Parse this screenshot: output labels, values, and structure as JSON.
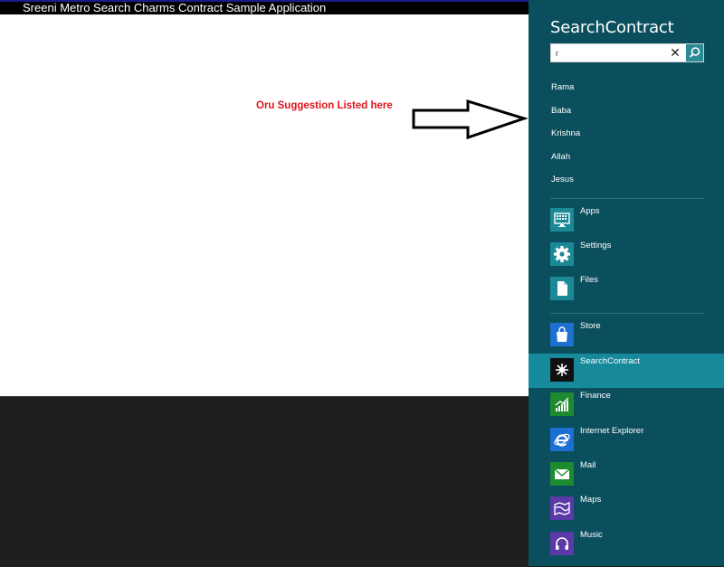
{
  "app": {
    "title": "Sreeni Metro Search Charms Contract Sample Application",
    "annotation": "Oru Suggestion Listed here"
  },
  "charm": {
    "title": "SearchContract",
    "search": {
      "value": "r",
      "placeholder": ""
    },
    "suggestions": [
      {
        "label": "Rama"
      },
      {
        "label": "Baba"
      },
      {
        "label": "Krishna"
      },
      {
        "label": "Allah"
      },
      {
        "label": "Jesus"
      }
    ],
    "system_targets": [
      {
        "label": "Apps",
        "icon": "apps-icon",
        "color": "#1b8a96"
      },
      {
        "label": "Settings",
        "icon": "gear-icon",
        "color": "#1b8a96"
      },
      {
        "label": "Files",
        "icon": "file-icon",
        "color": "#1b8a96"
      }
    ],
    "apps": [
      {
        "label": "Store",
        "icon": "store-icon",
        "color": "#1d6fd1"
      },
      {
        "label": "SearchContract",
        "icon": "searchcontract-icon",
        "color": "#111111",
        "selected": true
      },
      {
        "label": "Finance",
        "icon": "finance-icon",
        "color": "#1e8a2e"
      },
      {
        "label": "Internet Explorer",
        "icon": "internet-explorer-icon",
        "color": "#1d6fd1"
      },
      {
        "label": "Mail",
        "icon": "mail-icon",
        "color": "#1e8a2e"
      },
      {
        "label": "Maps",
        "icon": "maps-icon",
        "color": "#5b3aa8"
      },
      {
        "label": "Music",
        "icon": "music-icon",
        "color": "#5b3aa8"
      }
    ]
  }
}
